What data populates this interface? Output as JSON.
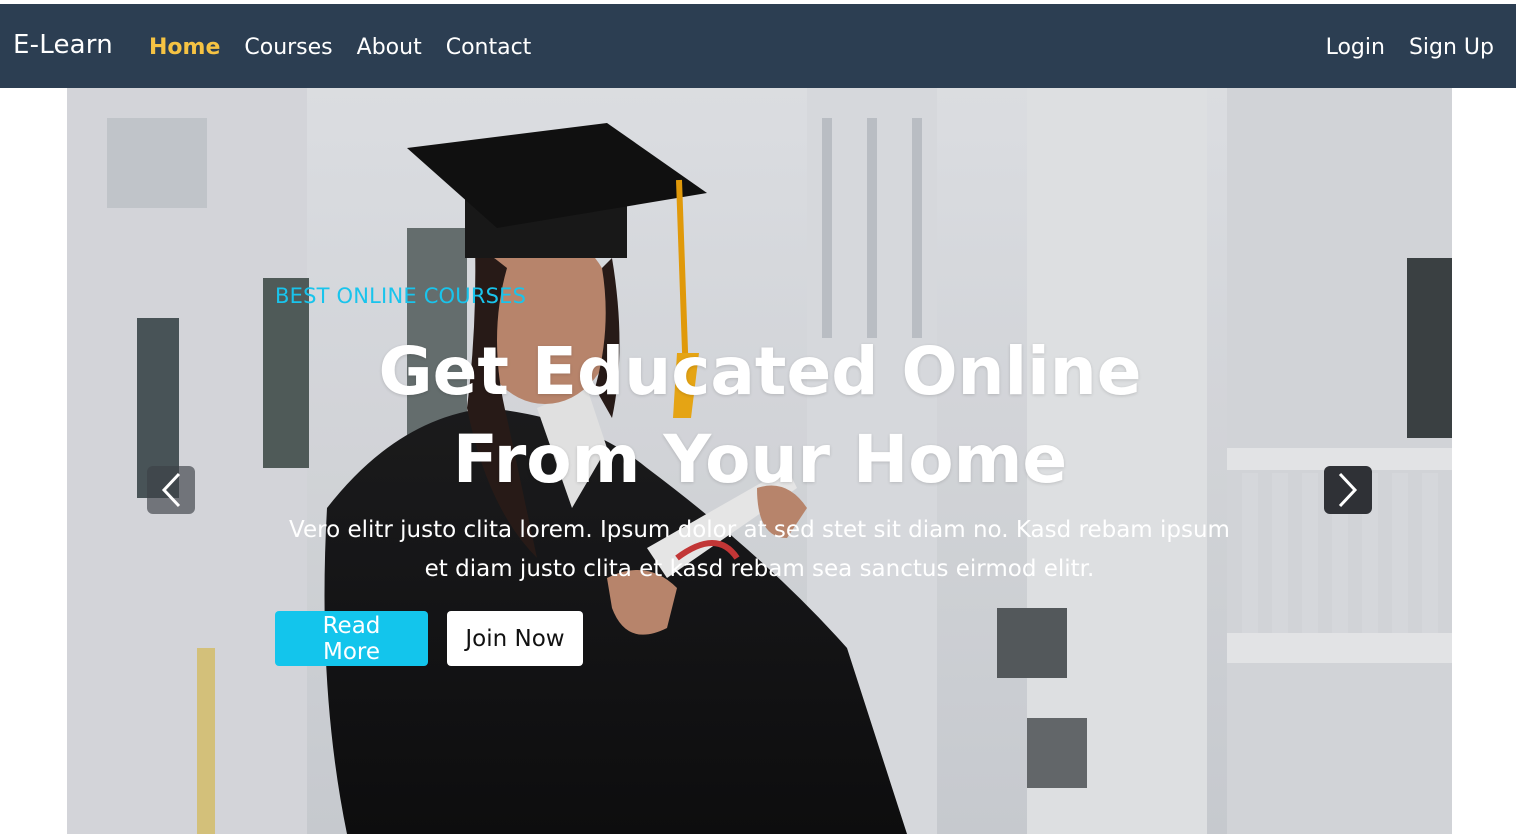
{
  "nav": {
    "brand": "E-Learn",
    "links": [
      "Home",
      "Courses",
      "About",
      "Contact"
    ],
    "active": "Home",
    "auth": [
      "Login",
      "Sign Up"
    ]
  },
  "hero": {
    "subtitle": "Best Online Courses",
    "headline": "Get Educated Online From Your Home",
    "lead": "Vero elitr justo clita lorem. Ipsum dolor at sed stet sit diam no. Kasd rebam ipsum et diam justo clita et kasd rebam sea sanctus eirmod elitr.",
    "read_more": "Read More",
    "join_now": "Join Now",
    "prev_icon": "chevron-left-icon",
    "next_icon": "chevron-right-icon"
  },
  "colors": {
    "navbar_bg": "#2c3e52",
    "active_link": "#f6c343",
    "accent": "#13c5ec",
    "subtitle": "#19c4ec"
  }
}
